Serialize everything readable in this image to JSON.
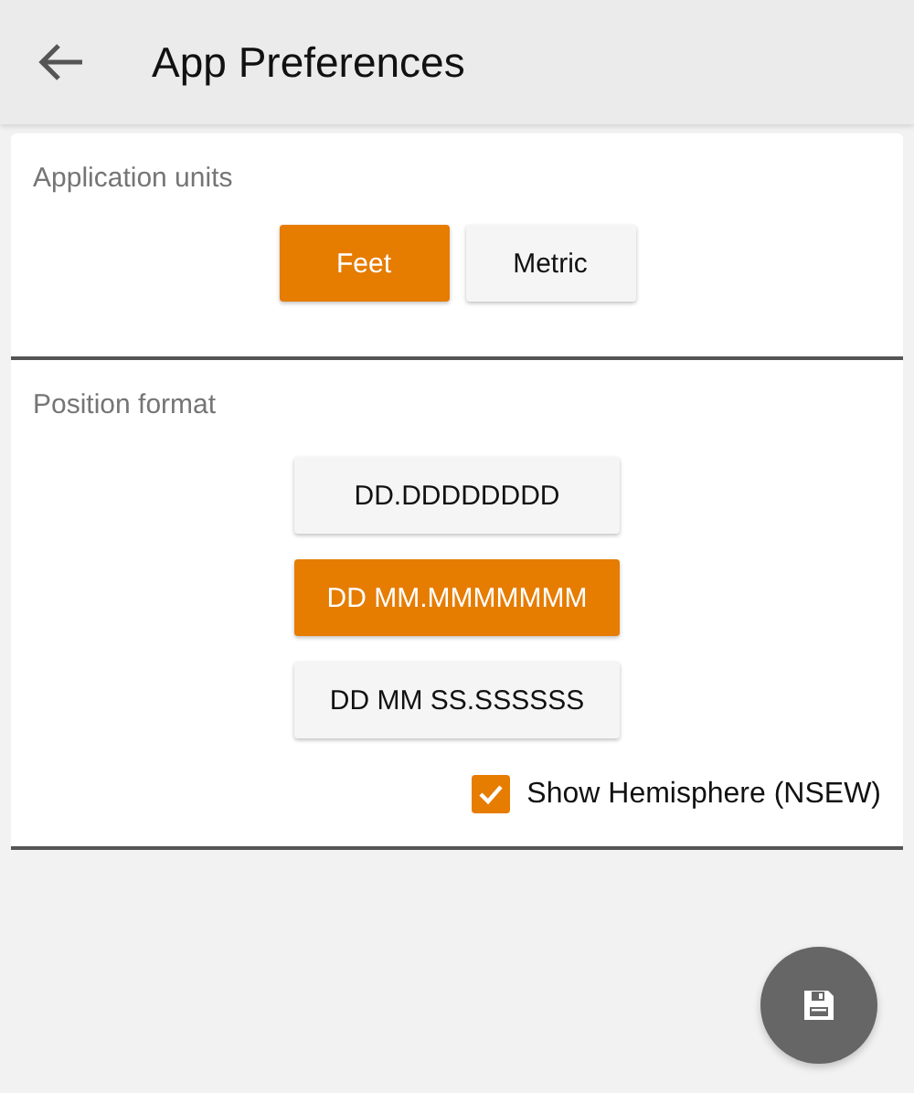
{
  "app_bar": {
    "title": "App Preferences"
  },
  "sections": [
    {
      "title": "Application units",
      "kind": "row",
      "options": [
        {
          "label": "Feet",
          "selected": true
        },
        {
          "label": "Metric",
          "selected": false
        }
      ]
    },
    {
      "title": "Position format",
      "kind": "column",
      "options": [
        {
          "label": "DD.DDDDDDDD",
          "selected": false
        },
        {
          "label": "DD MM.MMMMMMM",
          "selected": true
        },
        {
          "label": "DD MM SS.SSSSSS",
          "selected": false
        }
      ],
      "checkbox": {
        "label": "Show Hemisphere (NSEW)",
        "checked": true
      }
    }
  ]
}
